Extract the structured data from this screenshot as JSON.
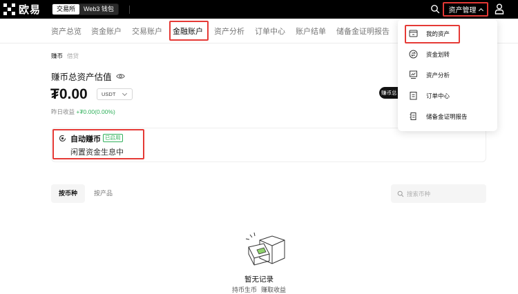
{
  "topbar": {
    "logo_text": "欧易",
    "segment": [
      "交易所",
      "Web3 钱包"
    ],
    "asset_menu_label": "资产管理"
  },
  "subnav": {
    "items": [
      "资产总览",
      "资金账户",
      "交易账户",
      "金融账户",
      "资产分析",
      "订单中心",
      "账户结单",
      "储备金证明报告"
    ],
    "active": "金融账户"
  },
  "main": {
    "crumbs": [
      "赚币",
      "借贷"
    ],
    "total_title": "赚币总资产估值",
    "balance": "₮0.00",
    "unit": "USDT",
    "yesterday_label": "昨日收益 ",
    "yesterday_value": "+₮0.00(0.00%)",
    "dark_pill": "赚币总"
  },
  "auto_earn": {
    "title": "自动赚币",
    "badge": "已启用",
    "subtitle": "闲置资金生息中"
  },
  "holdings": {
    "tabs": [
      "按币种",
      "按产品"
    ],
    "active_tab": "按币种",
    "search_placeholder": "搜索币种"
  },
  "empty": {
    "title": "暂无记录",
    "links": [
      "持币生币",
      "赚取收益"
    ]
  },
  "dropdown": {
    "items": [
      {
        "label": "我的资产",
        "icon": "wallet-icon"
      },
      {
        "label": "资金划转",
        "icon": "transfer-icon"
      },
      {
        "label": "资产分析",
        "icon": "analysis-icon"
      },
      {
        "label": "订单中心",
        "icon": "order-icon"
      },
      {
        "label": "储备金证明报告",
        "icon": "report-icon"
      }
    ]
  },
  "colors": {
    "highlight": "#e53935",
    "positive": "#2fb05a",
    "topbar": "#000000"
  }
}
